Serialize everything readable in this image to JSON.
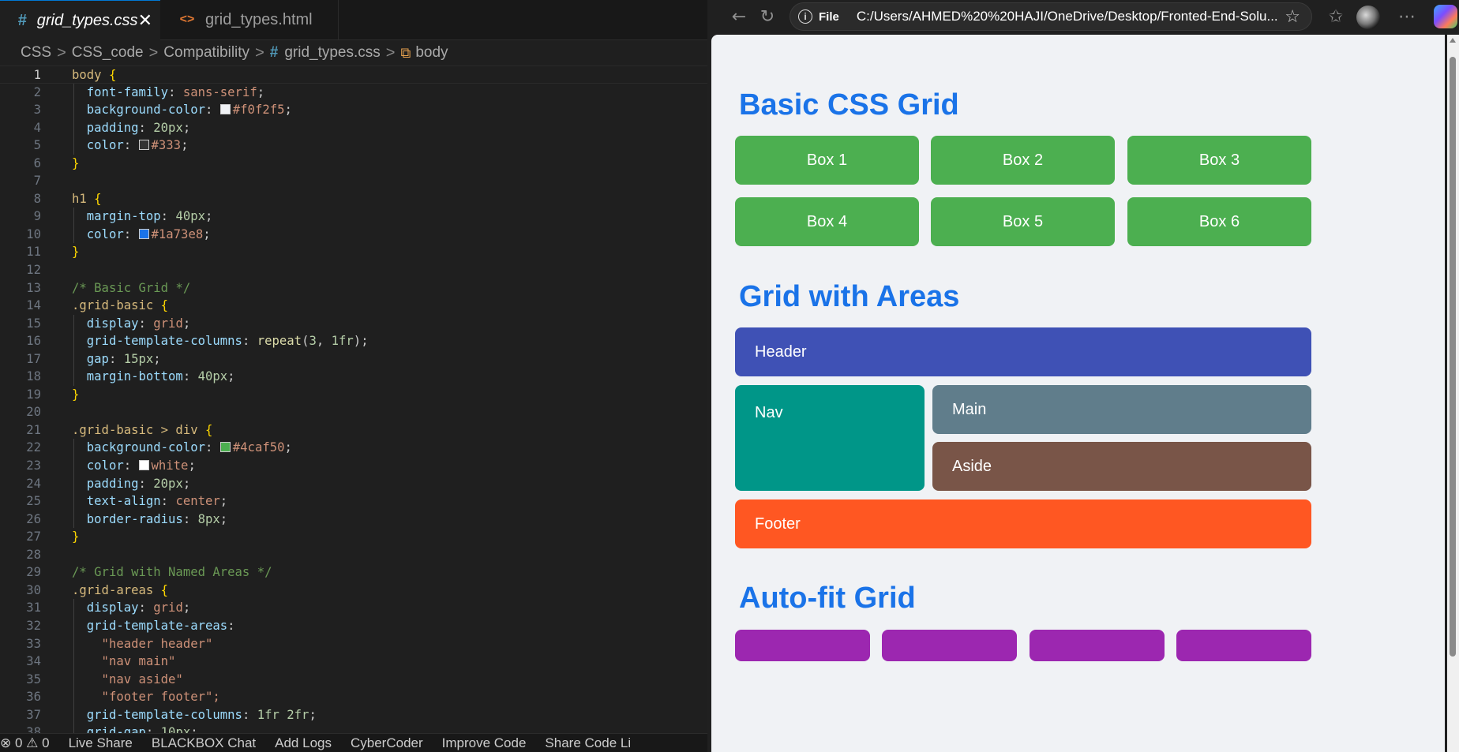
{
  "editor": {
    "tabs": [
      {
        "icon": "#",
        "label": "grid_types.css",
        "close": "✕"
      },
      {
        "icon": "<>",
        "label": "grid_types.html"
      }
    ],
    "breadcrumb": [
      "CSS",
      "CSS_code",
      "Compatibility",
      "grid_types.css",
      "body"
    ],
    "breadcrumb_separator": ">",
    "lines": [
      {
        "n": "1",
        "text": "body {"
      },
      {
        "n": "2",
        "text": "  font-family: sans-serif;"
      },
      {
        "n": "3",
        "text": "  background-color: #f0f2f5;"
      },
      {
        "n": "4",
        "text": "  padding: 20px;"
      },
      {
        "n": "5",
        "text": "  color: #333;"
      },
      {
        "n": "6",
        "text": "}"
      },
      {
        "n": "7",
        "text": ""
      },
      {
        "n": "8",
        "text": "h1 {"
      },
      {
        "n": "9",
        "text": "  margin-top: 40px;"
      },
      {
        "n": "10",
        "text": "  color: #1a73e8;"
      },
      {
        "n": "11",
        "text": "}"
      },
      {
        "n": "12",
        "text": ""
      },
      {
        "n": "13",
        "text": "/* Basic Grid */"
      },
      {
        "n": "14",
        "text": ".grid-basic {"
      },
      {
        "n": "15",
        "text": "  display: grid;"
      },
      {
        "n": "16",
        "text": "  grid-template-columns: repeat(3, 1fr);"
      },
      {
        "n": "17",
        "text": "  gap: 15px;"
      },
      {
        "n": "18",
        "text": "  margin-bottom: 40px;"
      },
      {
        "n": "19",
        "text": "}"
      },
      {
        "n": "20",
        "text": ""
      },
      {
        "n": "21",
        "text": ".grid-basic > div {"
      },
      {
        "n": "22",
        "text": "  background-color: #4caf50;"
      },
      {
        "n": "23",
        "text": "  color: white;"
      },
      {
        "n": "24",
        "text": "  padding: 20px;"
      },
      {
        "n": "25",
        "text": "  text-align: center;"
      },
      {
        "n": "26",
        "text": "  border-radius: 8px;"
      },
      {
        "n": "27",
        "text": "}"
      },
      {
        "n": "28",
        "text": ""
      },
      {
        "n": "29",
        "text": "/* Grid with Named Areas */"
      },
      {
        "n": "30",
        "text": ".grid-areas {"
      },
      {
        "n": "31",
        "text": "  display: grid;"
      },
      {
        "n": "32",
        "text": "  grid-template-areas:"
      },
      {
        "n": "33",
        "text": "    \"header header\""
      },
      {
        "n": "34",
        "text": "    \"nav main\""
      },
      {
        "n": "35",
        "text": "    \"nav aside\""
      },
      {
        "n": "36",
        "text": "    \"footer footer\";"
      },
      {
        "n": "37",
        "text": "  grid-template-columns: 1fr 2fr;"
      },
      {
        "n": "38",
        "text": "  grid-gap: 10px;"
      }
    ],
    "status_items": [
      "⊗ 0 ⚠ 0",
      "Live Share",
      "BLACKBOX Chat",
      "Add Logs",
      "CyberCoder",
      "Improve Code",
      "Share Code Li"
    ]
  },
  "browser": {
    "address_prefix": "File",
    "url": "C:/Users/AHMED%20%20HAJI/OneDrive/Desktop/Fronted-End-Solu...",
    "page": {
      "headings": [
        "Basic CSS Grid",
        "Grid with Areas",
        "Auto-fit Grid"
      ],
      "basic_boxes": [
        "Box 1",
        "Box 2",
        "Box 3",
        "Box 4",
        "Box 5",
        "Box 6"
      ],
      "areas": {
        "header": "Header",
        "nav": "Nav",
        "main": "Main",
        "aside": "Aside",
        "footer": "Footer"
      }
    }
  },
  "colors": {
    "heading": "#1a73e8",
    "basic_box": "#4caf50",
    "header": "#3f51b5",
    "nav": "#009688",
    "main": "#607d8b",
    "aside": "#795548",
    "footer": "#ff5722",
    "autofit": "#9c27b0",
    "page_bg": "#f0f2f5"
  }
}
